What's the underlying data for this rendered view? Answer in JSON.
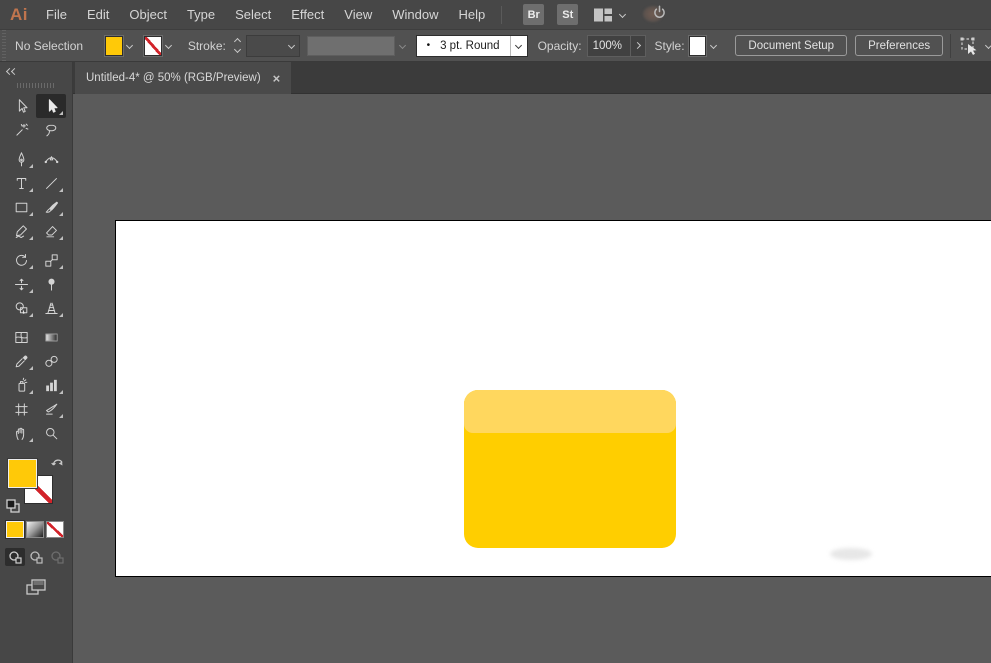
{
  "app": {
    "logo": "Ai"
  },
  "menubar": {
    "items": [
      "File",
      "Edit",
      "Object",
      "Type",
      "Select",
      "Effect",
      "View",
      "Window",
      "Help"
    ],
    "bridge_label": "Br",
    "stock_label": "St"
  },
  "control_bar": {
    "selection_status": "No Selection",
    "stroke_label": "Stroke:",
    "brush_bullet": "•",
    "brush_value": "3 pt. Round",
    "opacity_label": "Opacity:",
    "opacity_value": "100%",
    "style_label": "Style:",
    "document_setup_label": "Document Setup",
    "preferences_label": "Preferences"
  },
  "tab": {
    "title": "Untitled-4* @ 50% (RGB/Preview)",
    "zoom_level": "50%",
    "close_glyph": "×"
  },
  "toolbar": {
    "tools": [
      {
        "name": "selection"
      },
      {
        "name": "direct-selection",
        "selected": true,
        "flyout": true
      },
      {
        "name": "magic-wand"
      },
      {
        "name": "lasso"
      },
      {
        "name": "pen",
        "flyout": true
      },
      {
        "name": "curvature"
      },
      {
        "name": "type",
        "flyout": true
      },
      {
        "name": "line-segment",
        "flyout": true
      },
      {
        "name": "rectangle",
        "flyout": true
      },
      {
        "name": "paintbrush",
        "flyout": true
      },
      {
        "name": "shaper",
        "flyout": true
      },
      {
        "name": "eraser",
        "flyout": true
      },
      {
        "name": "rotate",
        "flyout": true
      },
      {
        "name": "scale",
        "flyout": true
      },
      {
        "name": "width",
        "flyout": true
      },
      {
        "name": "puppet-warp"
      },
      {
        "name": "shape-builder",
        "flyout": true
      },
      {
        "name": "perspective-grid",
        "flyout": true
      },
      {
        "name": "mesh"
      },
      {
        "name": "gradient"
      },
      {
        "name": "eyedropper",
        "flyout": true
      },
      {
        "name": "blend"
      },
      {
        "name": "symbol-sprayer",
        "flyout": true
      },
      {
        "name": "column-graph",
        "flyout": true
      },
      {
        "name": "artboard"
      },
      {
        "name": "slice",
        "flyout": true
      },
      {
        "name": "hand",
        "flyout": true
      },
      {
        "name": "zoom"
      }
    ]
  },
  "icons": {
    "chevron-down": "css-v-shape",
    "chevron-up": "css-v-shape",
    "collapse-panel": "double-chevron-left",
    "close": "×",
    "workspace-switcher": "panel-grid",
    "sync-power": "power-symbol",
    "select-similar": "dashed-box-cursor",
    "swap-fill-stroke": "bent-double-arrow",
    "default-fill-stroke": "mini-swatch-pair"
  },
  "colors": {
    "fill_yellow": "#FFC908",
    "shape_main": "#FFCE00",
    "shape_band": "#FFD75E",
    "none_red": "#D2232A",
    "artboard_white": "#FFFFFF",
    "pasteboard_gray": "#5B5B5B",
    "ui_gray": "#474747",
    "logo_orange": "#C1754E"
  }
}
